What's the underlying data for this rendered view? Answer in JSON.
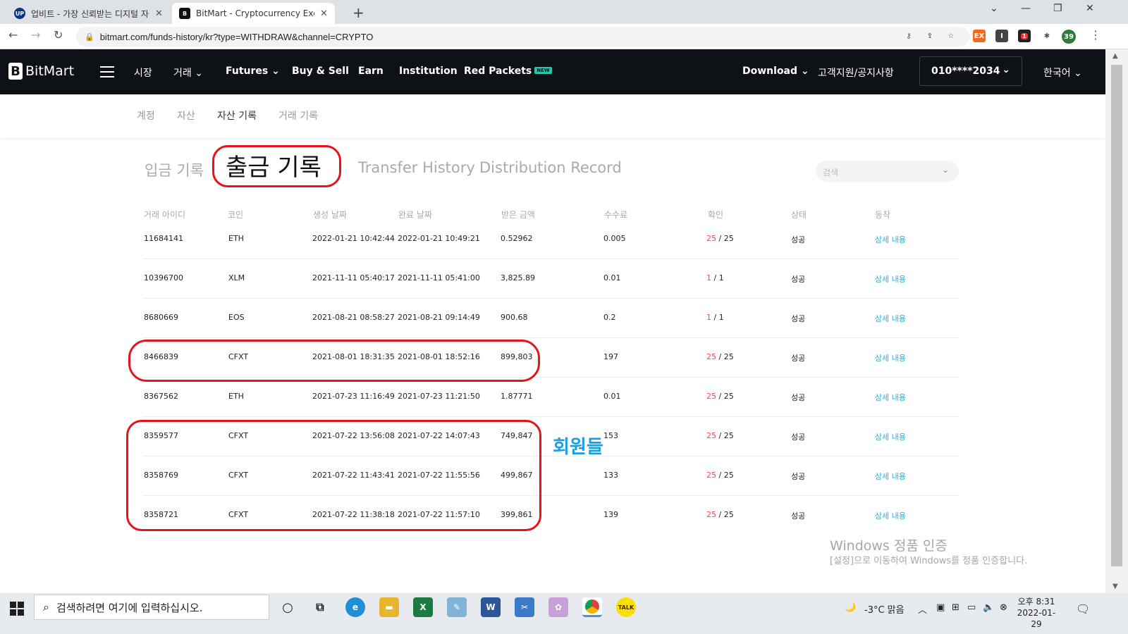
{
  "browser": {
    "tabs": [
      {
        "title": "업비트 - 가장 신뢰받는 디지털 자산 거래소",
        "favicon": "UP"
      },
      {
        "title": "BitMart - Cryptocurrency Exchange",
        "favicon": "B"
      }
    ],
    "url": "bitmart.com/funds-history/kr?type=WITHDRAW&channel=CRYPTO",
    "profile_badge": "39",
    "ext_badge": "1"
  },
  "header": {
    "logo": "BitMart",
    "nav": [
      "시장",
      "거래",
      "Futures",
      "Buy & Sell",
      "Earn",
      "Institution",
      "Red Packets"
    ],
    "new_badge": "NEW",
    "download": "Download",
    "support": "고객지원/공지사항",
    "account": "010****2034",
    "language": "한국어"
  },
  "subnav": [
    "계정",
    "자산",
    "자산 기록",
    "거래 기록"
  ],
  "history_tabs": [
    "입금 기록",
    "출금 기록",
    "Transfer History",
    "Distribution Record"
  ],
  "search_placeholder": "검색",
  "columns": [
    "거래 아이디",
    "코인",
    "생성 날짜",
    "완료 날짜",
    "받은 금액",
    "수수료",
    "확인",
    "상태",
    "동작"
  ],
  "rows": [
    {
      "id": "11684141",
      "coin": "ETH",
      "created": "2022-01-21 10:42:44",
      "completed": "2022-01-21 10:49:21",
      "amount": "0.52962",
      "fee": "0.005",
      "conf": "25",
      "conf_total": " / 25",
      "status": "성공",
      "action": "상세 내용"
    },
    {
      "id": "10396700",
      "coin": "XLM",
      "created": "2021-11-11 05:40:17",
      "completed": "2021-11-11 05:41:00",
      "amount": "3,825.89",
      "fee": "0.01",
      "conf": "1",
      "conf_total": " / 1",
      "status": "성공",
      "action": "상세 내용"
    },
    {
      "id": "8680669",
      "coin": "EOS",
      "created": "2021-08-21 08:58:27",
      "completed": "2021-08-21 09:14:49",
      "amount": "900.68",
      "fee": "0.2",
      "conf": "1",
      "conf_total": " / 1",
      "status": "성공",
      "action": "상세 내용"
    },
    {
      "id": "8466839",
      "coin": "CFXT",
      "created": "2021-08-01 18:31:35",
      "completed": "2021-08-01 18:52:16",
      "amount": "899,803",
      "fee": "197",
      "conf": "25",
      "conf_total": " / 25",
      "status": "성공",
      "action": "상세 내용"
    },
    {
      "id": "8367562",
      "coin": "ETH",
      "created": "2021-07-23 11:16:49",
      "completed": "2021-07-23 11:21:50",
      "amount": "1.87771",
      "fee": "0.01",
      "conf": "25",
      "conf_total": " / 25",
      "status": "성공",
      "action": "상세 내용"
    },
    {
      "id": "8359577",
      "coin": "CFXT",
      "created": "2021-07-22 13:56:08",
      "completed": "2021-07-22 14:07:43",
      "amount": "749,847",
      "fee": "153",
      "conf": "25",
      "conf_total": " / 25",
      "status": "성공",
      "action": "상세 내용"
    },
    {
      "id": "8358769",
      "coin": "CFXT",
      "created": "2021-07-22 11:43:41",
      "completed": "2021-07-22 11:55:56",
      "amount": "499,867",
      "fee": "133",
      "conf": "25",
      "conf_total": " / 25",
      "status": "성공",
      "action": "상세 내용"
    },
    {
      "id": "8358721",
      "coin": "CFXT",
      "created": "2021-07-22 11:38:18",
      "completed": "2021-07-22 11:57:10",
      "amount": "399,861",
      "fee": "139",
      "conf": "25",
      "conf_total": " / 25",
      "status": "성공",
      "action": "상세 내용"
    }
  ],
  "annotation_label": "회원들",
  "watermark": {
    "title": "Windows 정품 인증",
    "subtitle": "[설정]으로 이동하여 Windows를 정품 인증합니다."
  },
  "taskbar": {
    "search_placeholder": "검색하려면 여기에 입력하십시오.",
    "weather": "-3°C  맑음",
    "time": "오후 8:31",
    "date": "2022-01-29"
  },
  "colors": {
    "header_bg": "#0e1116",
    "accent_teal": "#23c9a9",
    "link": "#33a8d8",
    "confirm_red": "#e84b4b",
    "annotation_red": "#e3141c"
  }
}
